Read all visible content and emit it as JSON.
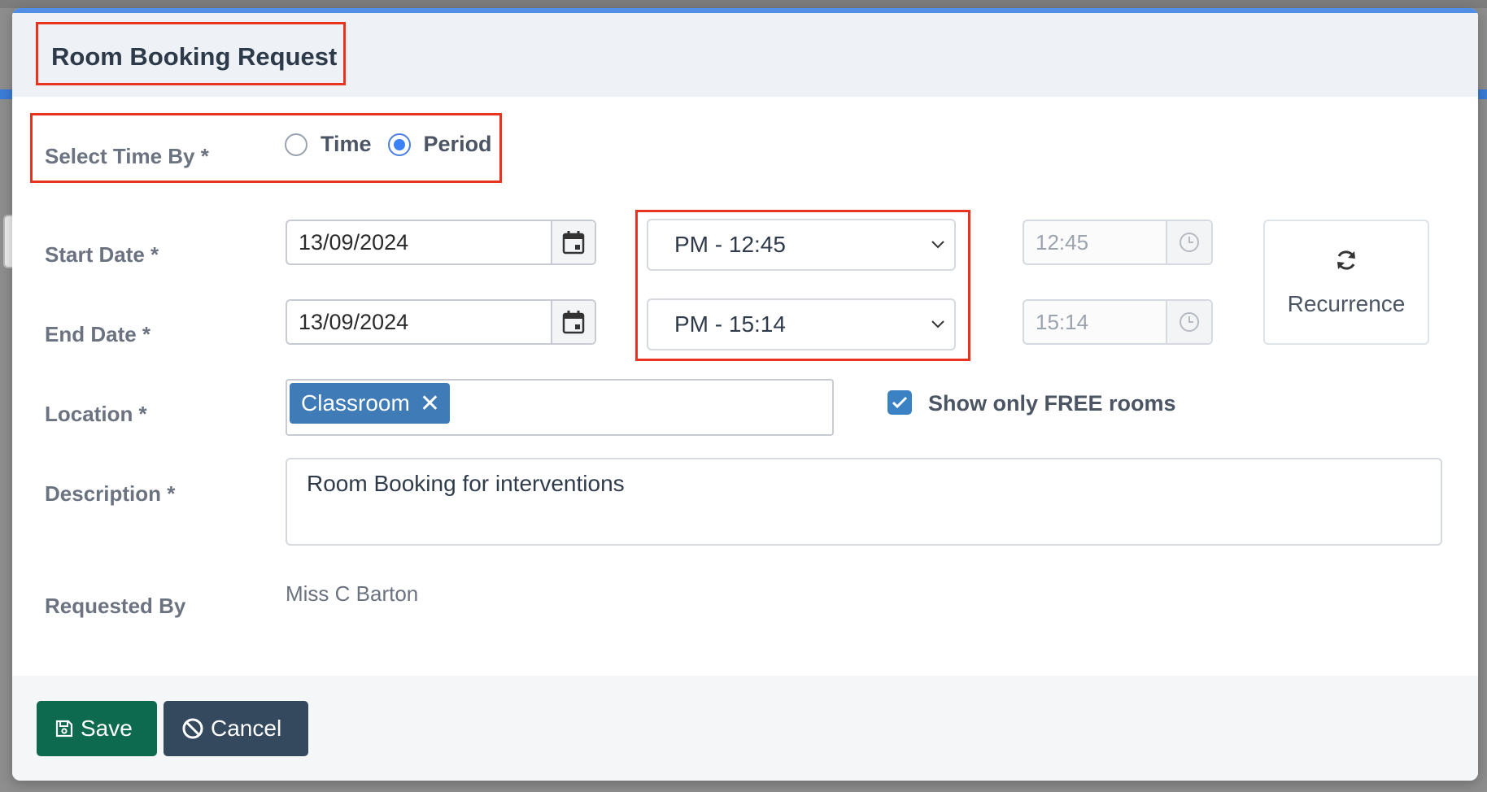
{
  "dialog": {
    "title": "Room Booking Request"
  },
  "select_time_by": {
    "label": "Select Time By *",
    "options": [
      {
        "label": "Time",
        "selected": false
      },
      {
        "label": "Period",
        "selected": true
      }
    ]
  },
  "start": {
    "label": "Start Date *",
    "date": "13/09/2024",
    "period": "PM - 12:45",
    "time": "12:45"
  },
  "end": {
    "label": "End Date *",
    "date": "13/09/2024",
    "period": "PM - 15:14",
    "time": "15:14"
  },
  "recurrence": {
    "label": "Recurrence",
    "icon": "refresh-icon"
  },
  "location": {
    "label": "Location *",
    "tags": [
      "Classroom"
    ],
    "show_free_label": "Show only FREE rooms",
    "show_free_checked": true
  },
  "description": {
    "label": "Description *",
    "value": "Room Booking for interventions"
  },
  "requested_by": {
    "label": "Requested By",
    "value": "Miss C Barton"
  },
  "footer": {
    "save_label": "Save",
    "cancel_label": "Cancel"
  },
  "colors": {
    "accent": "#3b82f6",
    "save": "#0d6a4e",
    "cancel": "#34495e",
    "tag": "#3f7bb6",
    "highlight": "#e8341f"
  }
}
